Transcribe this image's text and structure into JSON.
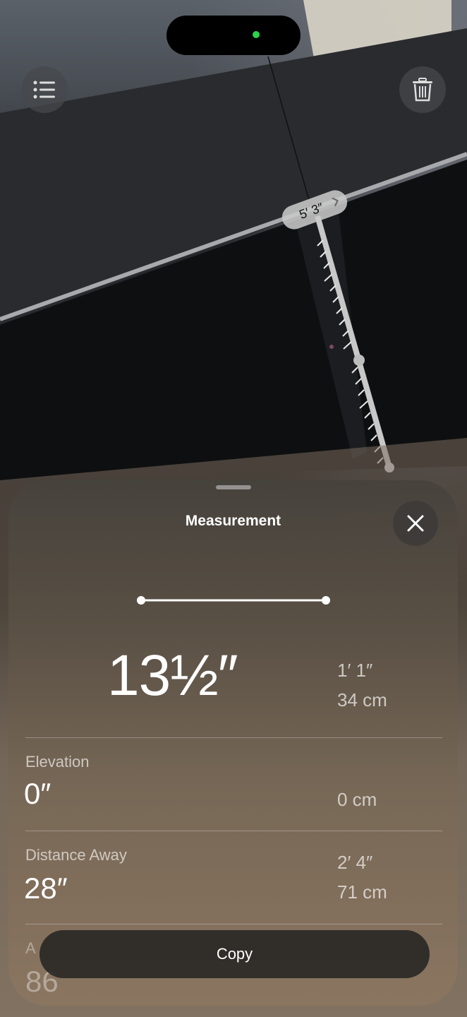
{
  "ar_view": {
    "measurement_label": "5′ 3″"
  },
  "icons": {
    "list": "list-icon",
    "trash": "trash-icon",
    "close": "close-icon",
    "chevron": "chevron-right-icon"
  },
  "sheet": {
    "title": "Measurement",
    "primary_value": "13½″",
    "primary_alt_1": "1′ 1″",
    "primary_alt_2": "34 cm",
    "rows": [
      {
        "label": "Elevation",
        "value": "0″",
        "alt_1": "",
        "alt_2": "0 cm"
      },
      {
        "label": "Distance Away",
        "value": "28″",
        "alt_1": "2′ 4″",
        "alt_2": "71 cm"
      }
    ],
    "partial_row": {
      "label": "A",
      "value": "86"
    },
    "copy_label": "Copy"
  },
  "colors": {
    "status_dot": "#2bd24a"
  }
}
